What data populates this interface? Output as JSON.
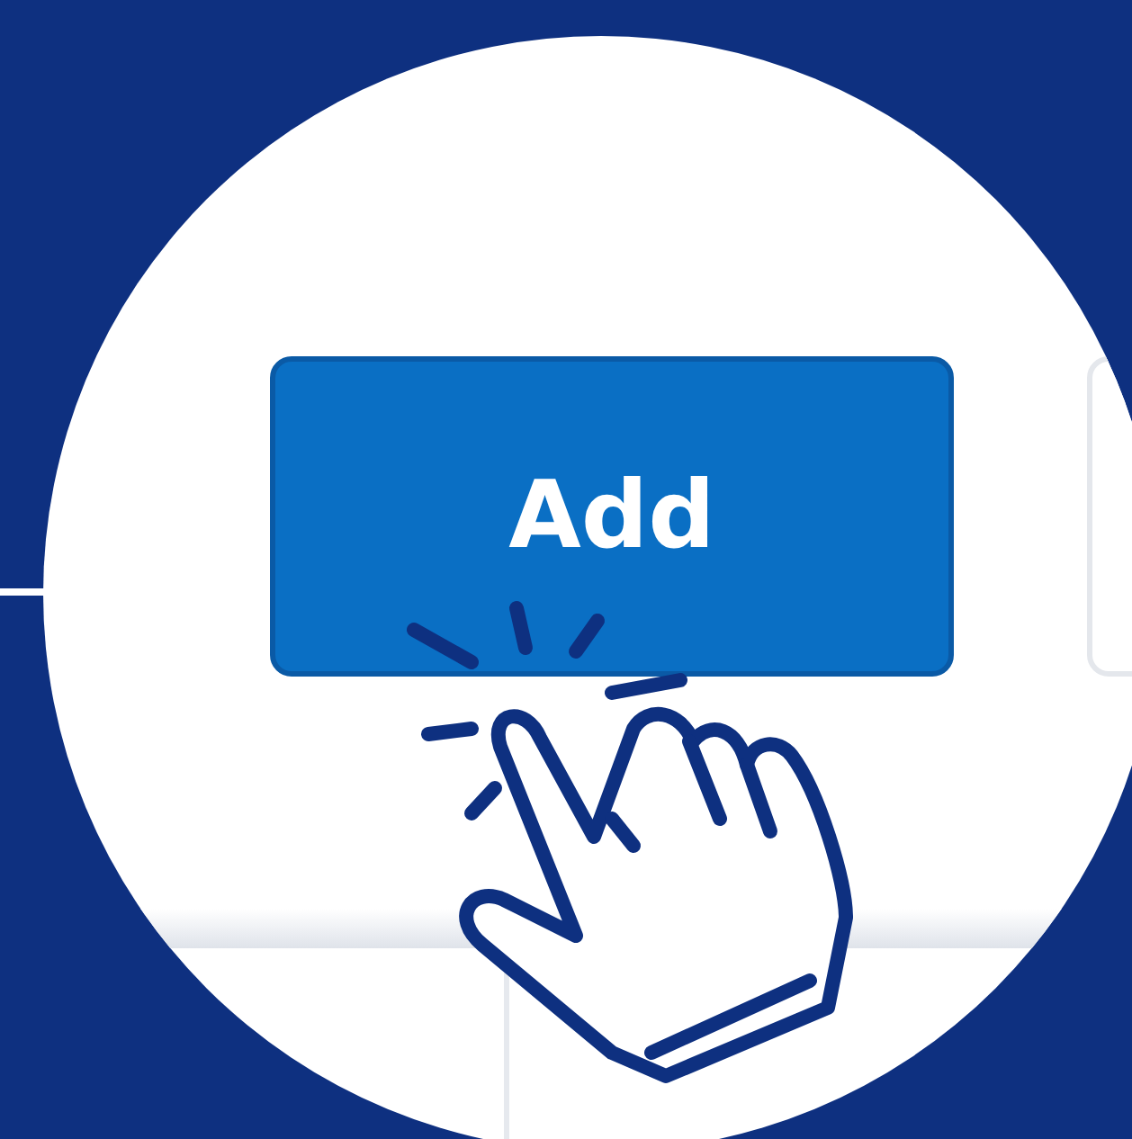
{
  "button": {
    "label": "Add"
  }
}
